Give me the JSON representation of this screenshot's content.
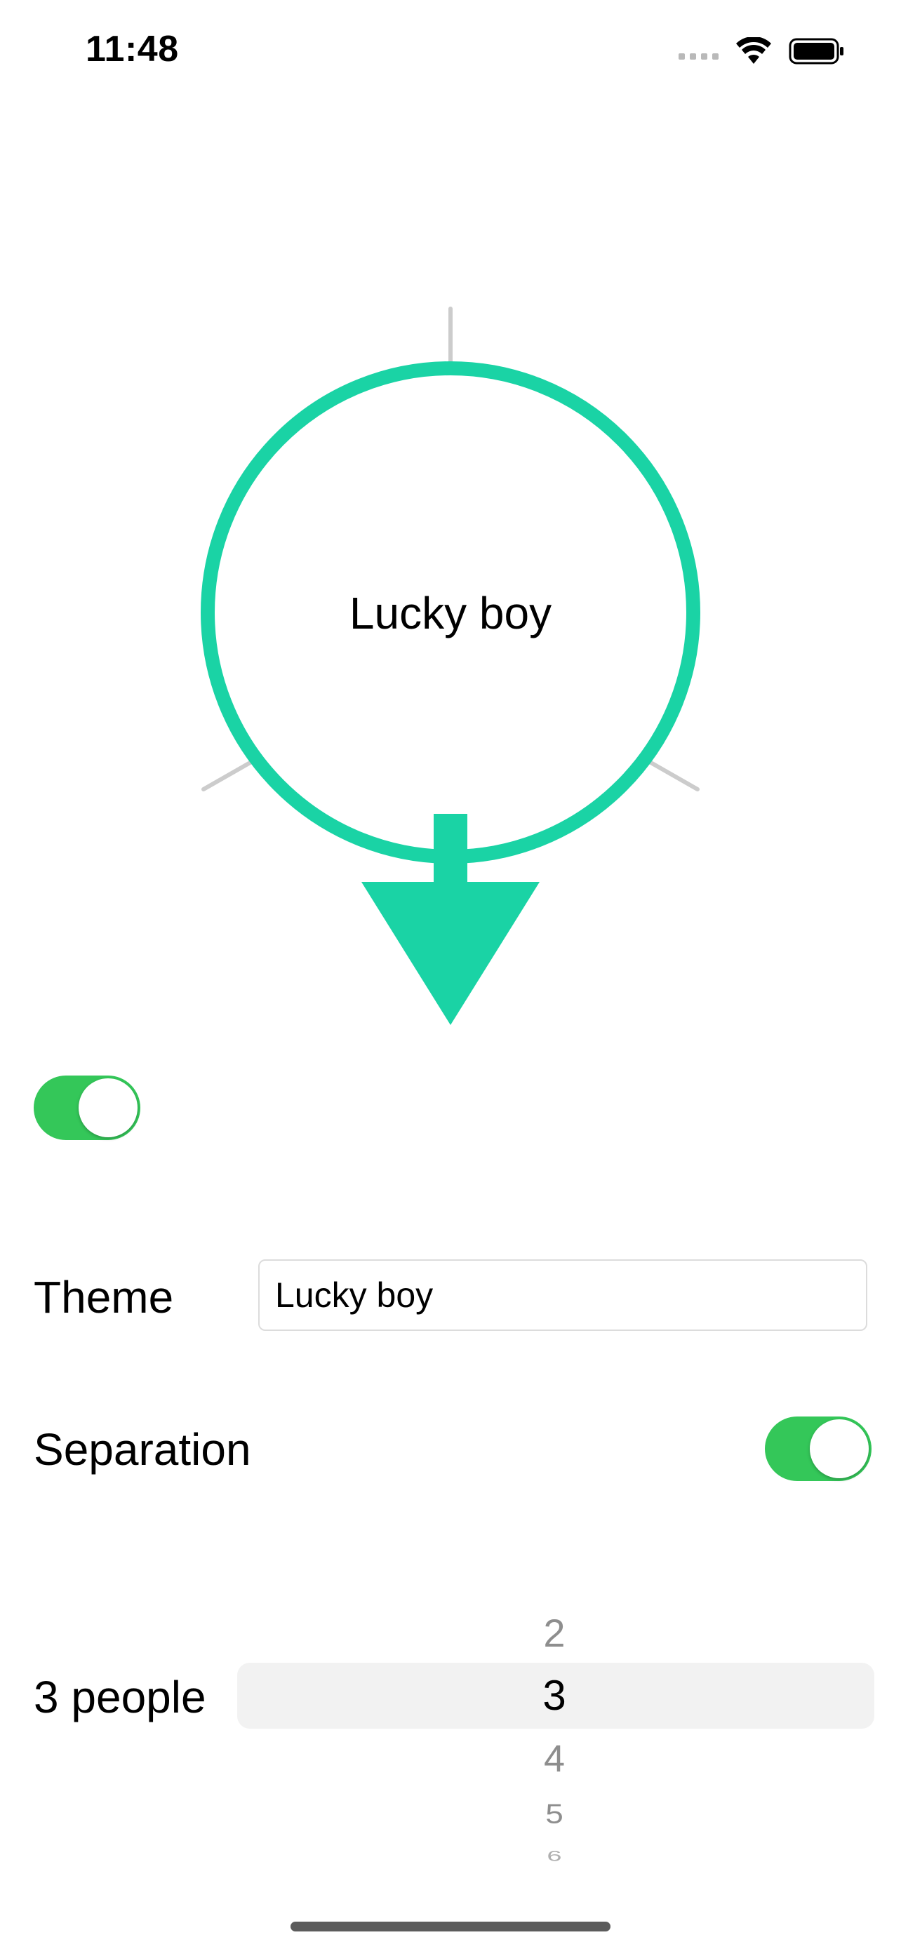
{
  "status_bar": {
    "time": "11:48",
    "icons": [
      "signal-dots-icon",
      "wifi-icon",
      "battery-icon"
    ]
  },
  "wheel": {
    "title": "Lucky boy",
    "ring_color": "#1ad3a5",
    "pointer_color": "#1ad3a5",
    "divider_color": "#cccccc"
  },
  "main_toggle": {
    "on": true,
    "color": "#34c759"
  },
  "theme_row": {
    "label": "Theme",
    "value": "Lucky boy"
  },
  "separation_row": {
    "label": "Separation",
    "on": true
  },
  "people_row": {
    "label": "3 people",
    "picker_options": [
      "2",
      "3",
      "4",
      "5",
      "6"
    ],
    "selected": "3"
  }
}
